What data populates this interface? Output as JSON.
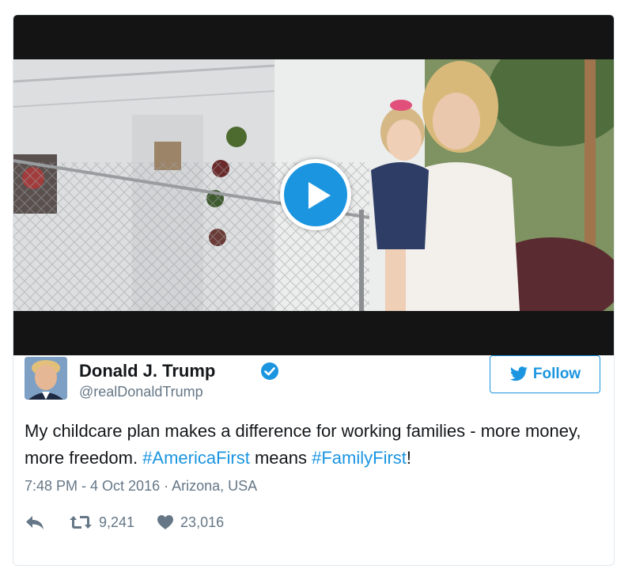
{
  "video": {
    "play_icon": "play-icon"
  },
  "tweet": {
    "author_name": "Donald J. Trump",
    "handle": "@realDonaldTrump",
    "verified_icon": "verified-badge-icon",
    "follow_label": "Follow",
    "text_parts": {
      "part1": "My childcare plan makes a difference for working families - more money, more freedom. ",
      "hashtag1": "#AmericaFirst",
      "part2": " means ",
      "hashtag2": "#FamilyFirst",
      "part3": "!"
    },
    "timestamp": "7:48 PM - 4 Oct 2016",
    "separator": " · ",
    "location": "Arizona, USA",
    "retweets": "9,241",
    "likes": "23,016"
  },
  "colors": {
    "accent": "#1b95e0",
    "muted": "#657786",
    "text": "#14171a"
  }
}
